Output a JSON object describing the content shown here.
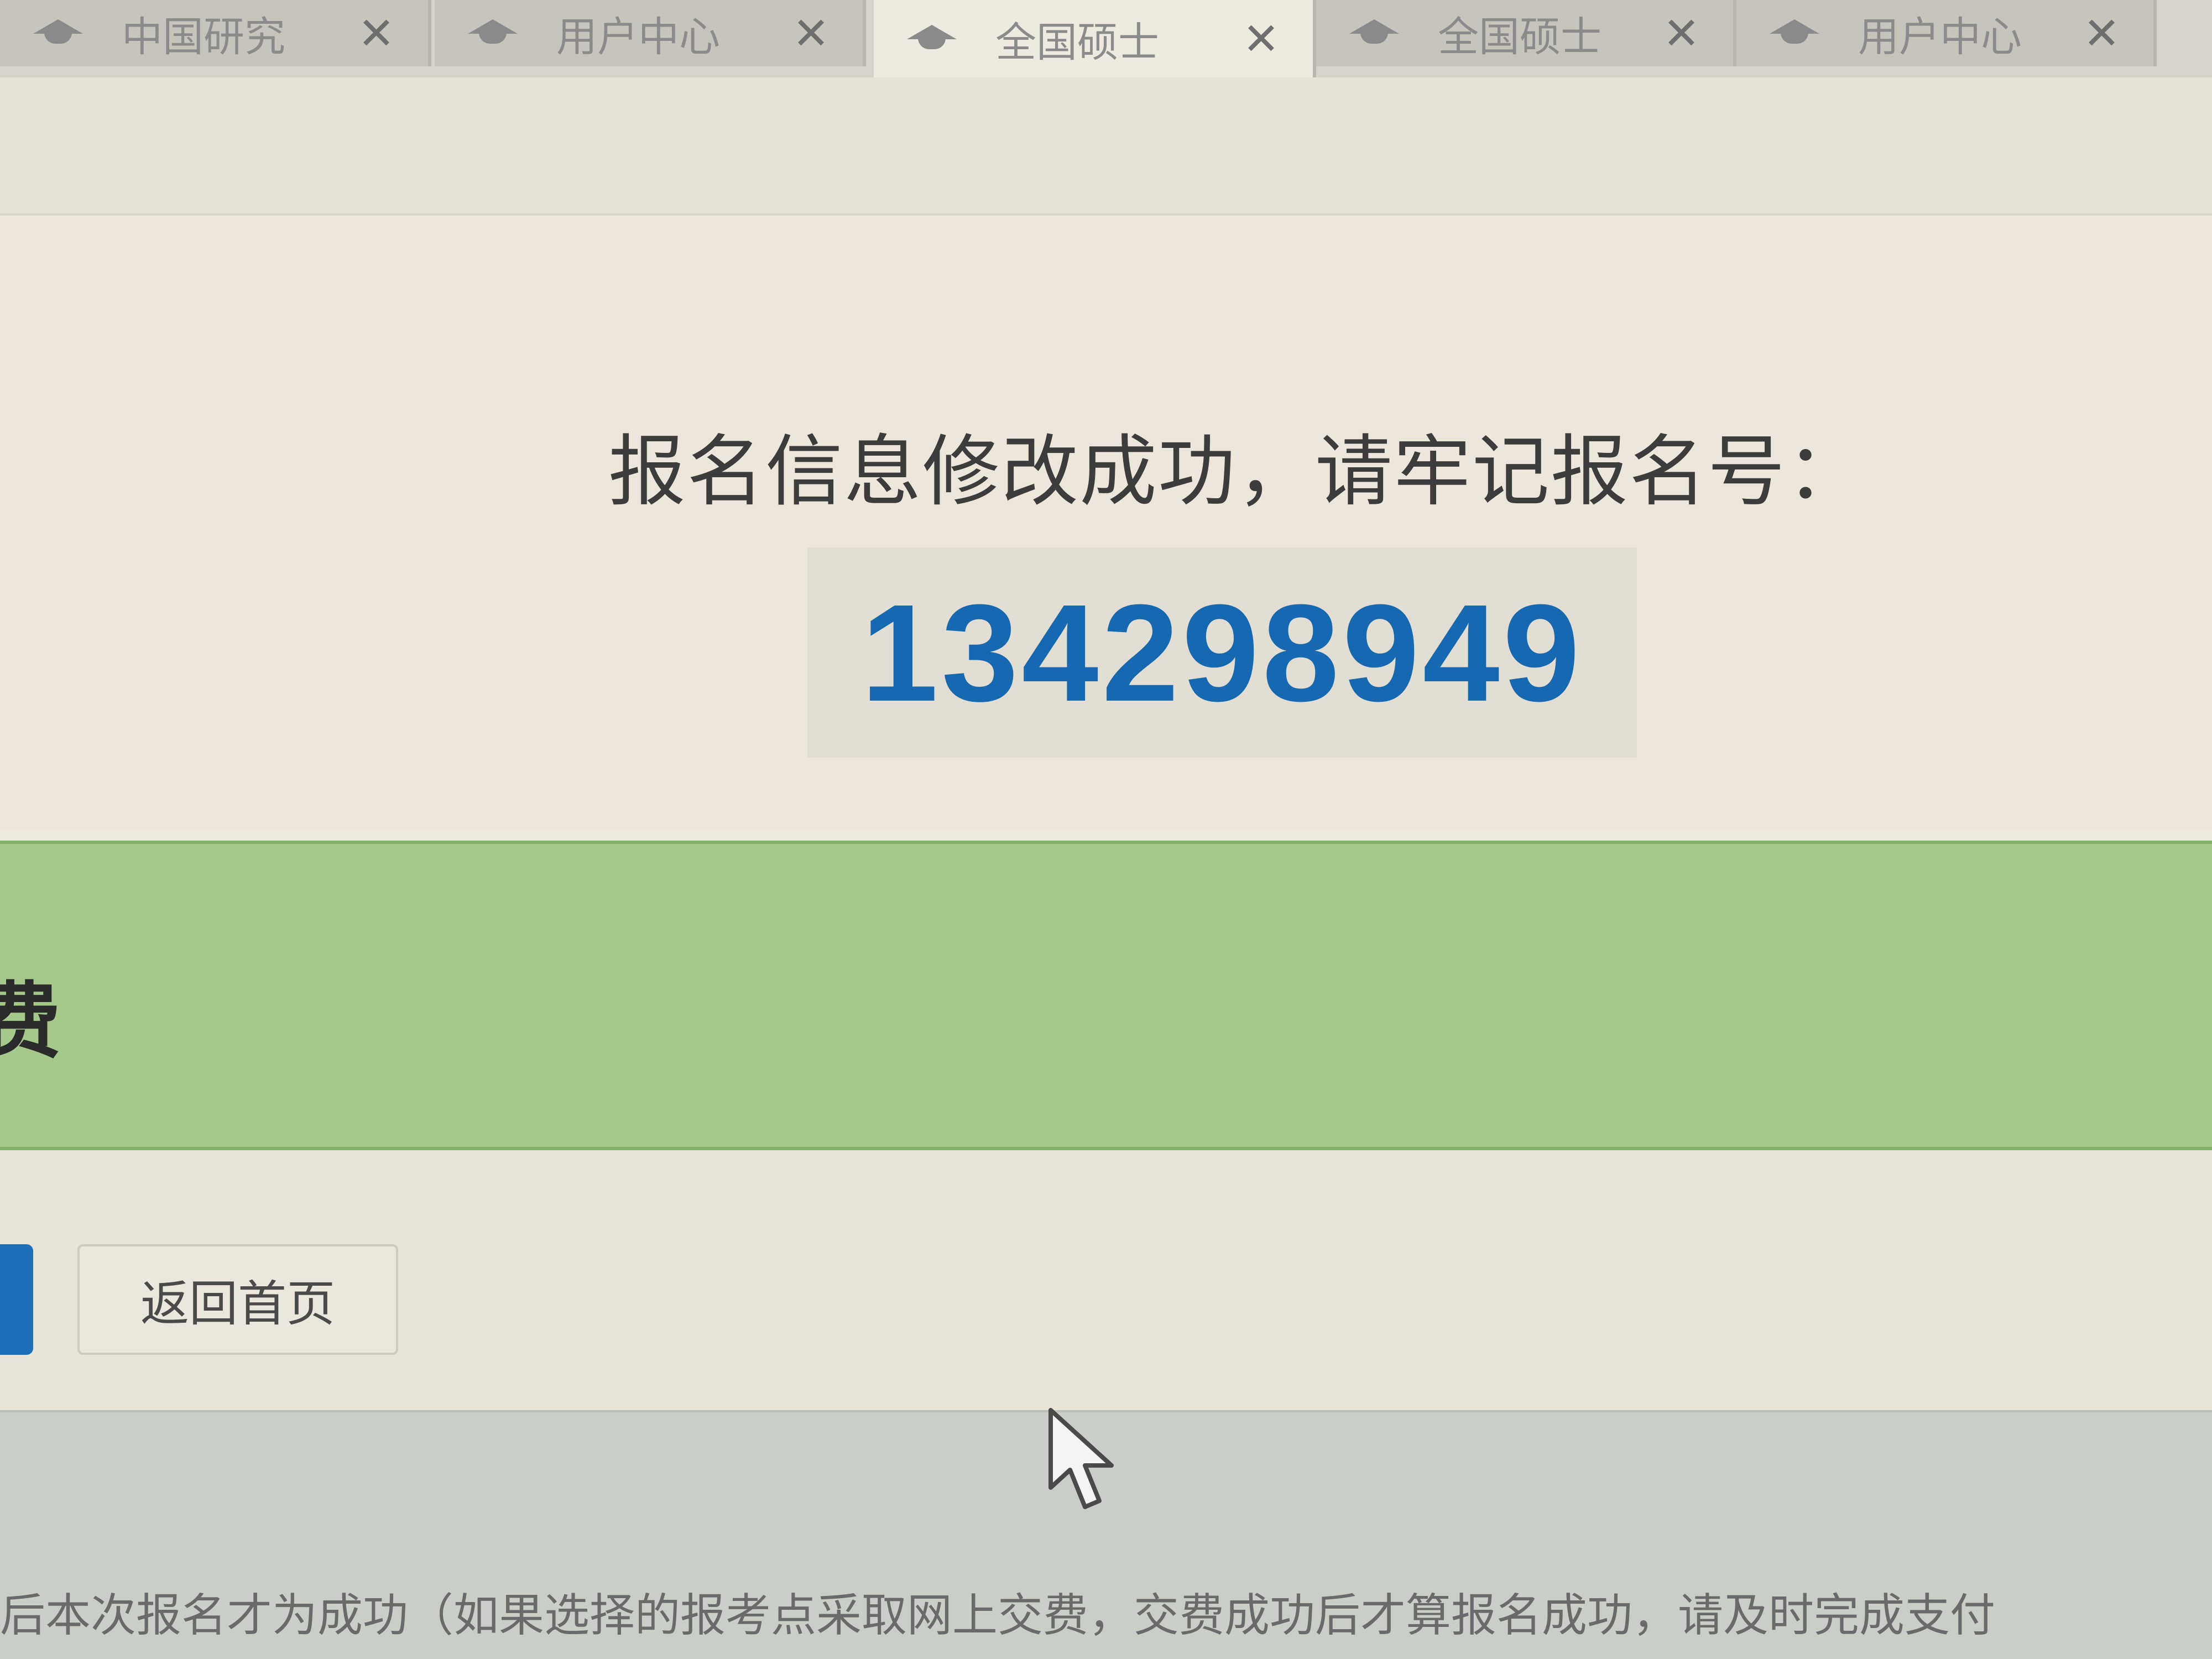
{
  "tabs": [
    {
      "label": "中国研究",
      "active": false
    },
    {
      "label": "用户中心",
      "active": false
    },
    {
      "label": "全国硕士",
      "active": true
    },
    {
      "label": "全国硕士",
      "active": false
    },
    {
      "label": "用户中心",
      "active": false
    }
  ],
  "main": {
    "message": "报名信息修改成功，请牢记报名号：",
    "registration_number": "134298949"
  },
  "section": {
    "partial_title": "费"
  },
  "actions": {
    "home_label": "返回首页"
  },
  "footer": {
    "notice": "后本次报名才为成功（如果选择的报考点采取网上交费，交费成功后才算报名成功，请及时完成支付"
  },
  "colors": {
    "number": "#1668b0",
    "green_band": "#a4c98a",
    "blue_button": "#1d6fb8"
  }
}
